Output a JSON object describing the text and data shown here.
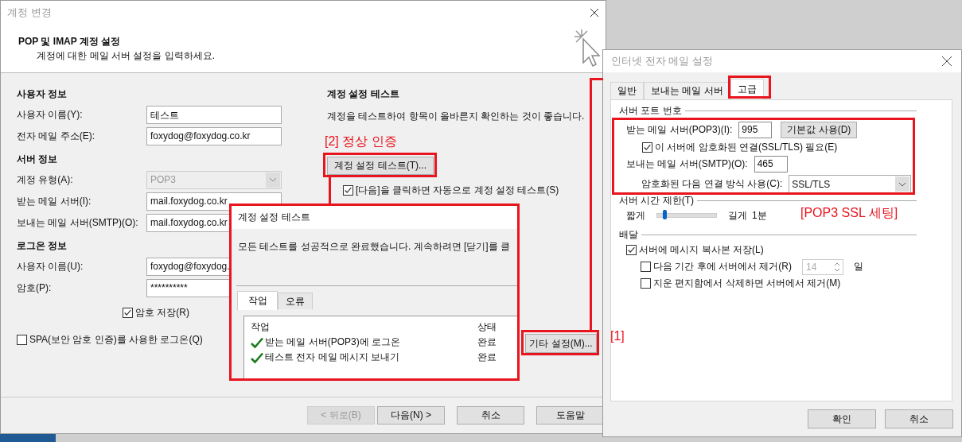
{
  "main_window": {
    "title": "계정 변경",
    "heading": "POP 및 IMAP 계정 설정",
    "subheading": "계정에 대한 메일 서버 설정을 입력하세요.",
    "sections": [
      {
        "title": "사용자 정보",
        "fields": [
          {
            "label": "사용자 이름(Y):",
            "value": "테스트",
            "kind": "text",
            "disabled": false
          },
          {
            "label": "전자 메일 주소(E):",
            "value": "foxydog@foxydog.co.kr",
            "kind": "text",
            "disabled": false
          }
        ]
      },
      {
        "title": "서버 정보",
        "fields": [
          {
            "label": "계정 유형(A):",
            "value": "POP3",
            "kind": "select",
            "disabled": true
          },
          {
            "label": "받는 메일 서버(I):",
            "value": "mail.foxydog.co.kr",
            "kind": "text",
            "disabled": false
          },
          {
            "label": "보내는 메일 서버(SMTP)(O):",
            "value": "mail.foxydog.co.kr",
            "kind": "text",
            "disabled": false
          }
        ]
      },
      {
        "title": "로그온 정보",
        "fields": [
          {
            "label": "사용자 이름(U):",
            "value": "foxydog@foxydog.",
            "kind": "text",
            "disabled": false
          },
          {
            "label": "암호(P):",
            "value": "**********",
            "kind": "text",
            "disabled": false
          }
        ]
      }
    ],
    "save_password": {
      "label": "암호 저장(R)",
      "checked": true
    },
    "spa": {
      "label": "SPA(보안 암호 인증)를 사용한 로그온(Q)",
      "checked": false
    },
    "test_section": {
      "title": "계정 설정 테스트",
      "description": "계정을 테스트하여 항목이 올바른지 확인하는 것이 좋습니다.",
      "button": "계정 설정 테스트(T)...",
      "auto_test": {
        "label": "[다음]을 클릭하면 자동으로 계정 설정 테스트(S)",
        "checked": true
      }
    },
    "more_settings_button": "기타 설정(M)...",
    "buttons": [
      {
        "label": "< 뒤로(B)",
        "disabled": true
      },
      {
        "label": "다음(N) >",
        "disabled": false
      },
      {
        "label": "취소",
        "disabled": false
      },
      {
        "label": "도움말",
        "disabled": false
      }
    ]
  },
  "test_dialog": {
    "title": "계정 설정 테스트",
    "message": "모든 테스트를 성공적으로 완료했습니다. 계속하려면 [닫기]를 클",
    "tabs": [
      {
        "label": "작업",
        "selected": true
      },
      {
        "label": "오류",
        "selected": false
      }
    ],
    "columns": [
      "작업",
      "상태"
    ],
    "rows": [
      {
        "task": "받는 메일 서버(POP3)에 로그온",
        "status": "완료",
        "done": true
      },
      {
        "task": "테스트 전자 메일 메시지 보내기",
        "status": "완료",
        "done": true
      }
    ]
  },
  "settings_dialog": {
    "title": "인터넷 전자 메일 설정",
    "tabs": [
      {
        "label": "일반",
        "selected": false
      },
      {
        "label": "보내는 메일 서버",
        "selected": false
      },
      {
        "label": "고급",
        "selected": true
      }
    ],
    "port_section": {
      "title": "서버 포트 번호",
      "incoming_label": "받는 메일 서버(POP3)(I):",
      "incoming_port": "995",
      "default_button": "기본값 사용(D)",
      "ssl": {
        "label": "이 서버에 암호화된 연결(SSL/TLS) 필요(E)",
        "checked": true
      },
      "outgoing_label": "보내는 메일 서버(SMTP)(O):",
      "outgoing_port": "465",
      "encryption_label": "암호화된 다음 연결 방식 사용(C):",
      "encryption_value": "SSL/TLS"
    },
    "timeout_section": {
      "title": "서버 시간 제한(T)",
      "short_label": "짧게",
      "long_label": "길게",
      "level": 0.1,
      "reading": "1분"
    },
    "delivery_section": {
      "title": "배달",
      "options": [
        {
          "label": "서버에 메시지 복사본 저장(L)",
          "checked": true,
          "kind": "plain"
        },
        {
          "label": "다음 기간 후에 서버에서 제거(R)",
          "checked": false,
          "kind": "days",
          "days": "14",
          "unit": "일"
        },
        {
          "label": "지운 편지함에서 삭제하면 서버에서 제거(M)",
          "checked": false,
          "kind": "plain"
        }
      ]
    },
    "buttons": [
      "확인",
      "취소"
    ]
  },
  "annotations": [
    {
      "text": "[2] 정상 인증",
      "kind": "auth"
    },
    {
      "text": "[POP3 SSL 세팅]",
      "kind": "ssl"
    },
    {
      "text": "[1]",
      "kind": "more"
    }
  ]
}
